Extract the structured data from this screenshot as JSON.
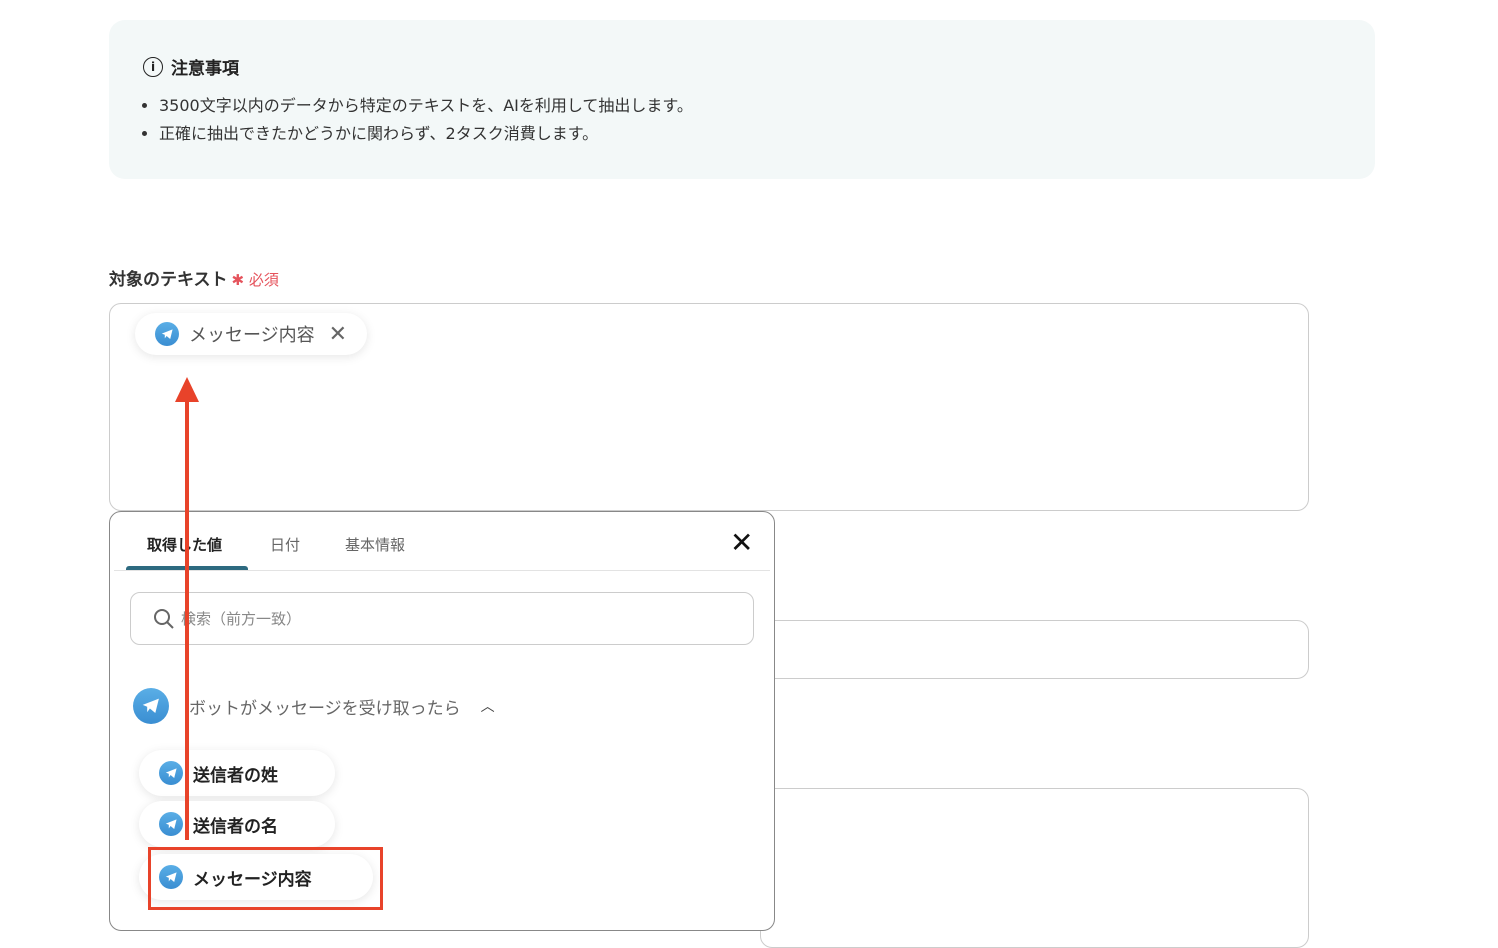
{
  "notice": {
    "title": "注意事項",
    "items": [
      "3500文字以内のデータから特定のテキストを、AIを利用して抽出します。",
      "正確に抽出できたかどうかに関わらず、2タスク消費します。"
    ]
  },
  "field": {
    "label": "対象のテキスト",
    "required": "必須",
    "token": "メッセージ内容"
  },
  "popup": {
    "tabs": [
      "取得した値",
      "日付",
      "基本情報"
    ],
    "search_placeholder": "検索（前方一致）",
    "group": "ボットがメッセージを受け取ったら",
    "items": [
      "送信者の姓",
      "送信者の名",
      "メッセージ内容"
    ]
  },
  "colors": {
    "accent": "#2d6a80",
    "annotation": "#e8432a",
    "telegram": "#3a8ed2"
  }
}
